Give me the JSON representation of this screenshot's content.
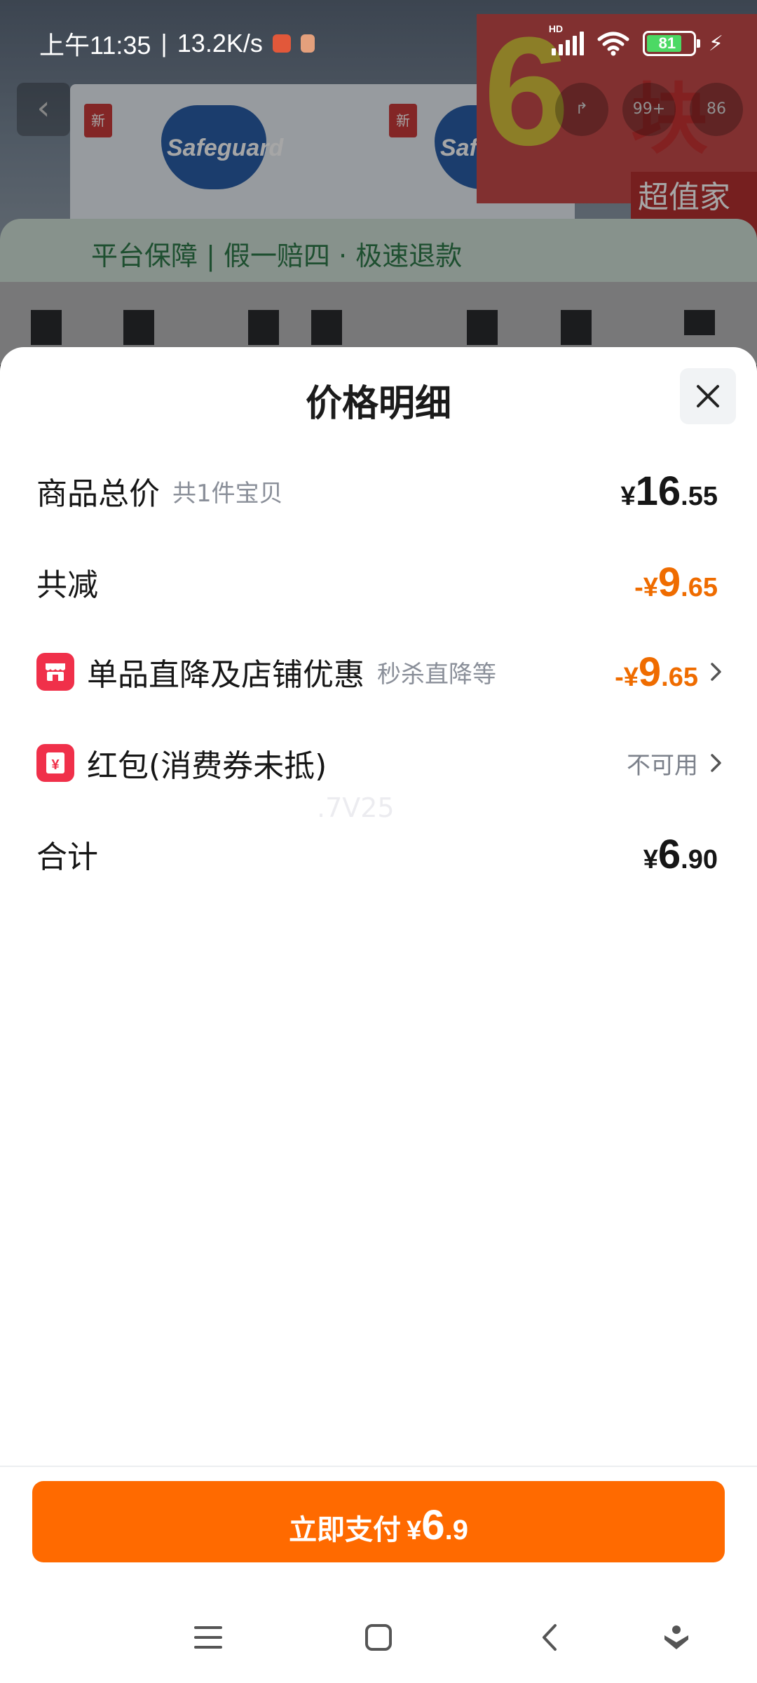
{
  "status_bar": {
    "time": "上午11:35",
    "network_speed": "13.2K/s",
    "signal_label": "HD",
    "battery": "81"
  },
  "background": {
    "brand": "Safeguard",
    "new_tag": "新",
    "promo_number": "6",
    "promo_word": "块装",
    "promo_sub": "超值家庭装",
    "badge_count": "99+",
    "badge_count2": "86",
    "guarantee_text": "平台保障 | 假一赔四 · 极速退款"
  },
  "sheet": {
    "title": "价格明细",
    "rows": [
      {
        "label": "商品总价",
        "note": "共1件宝贝",
        "currency": "¥",
        "int": "16",
        "dec": ".55"
      },
      {
        "label": "共减",
        "currency": "-¥",
        "int": "9",
        "dec": ".65"
      },
      {
        "label": "单品直降及店铺优惠",
        "note": "秒杀直降等",
        "currency": "-¥",
        "int": "9",
        "dec": ".65"
      },
      {
        "label": "红包(消费券未抵)",
        "status": "不可用"
      },
      {
        "label": "合计",
        "currency": "¥",
        "int": "6",
        "dec": ".90"
      }
    ],
    "watermark": ".7V25"
  },
  "pay_button": {
    "label": "立即支付",
    "currency": "¥",
    "int": "6",
    "dec": ".9"
  },
  "colors": {
    "accent": "#ff6a00",
    "discount": "#ef6c00",
    "icon_red": "#f0304a"
  },
  "icons": {
    "close": "close-icon",
    "shop": "shop-icon",
    "redpacket": "red-packet-icon",
    "chevron": "chevron-right-icon",
    "nav": [
      "menu-icon",
      "home-icon",
      "back-icon",
      "assistant-icon"
    ]
  }
}
